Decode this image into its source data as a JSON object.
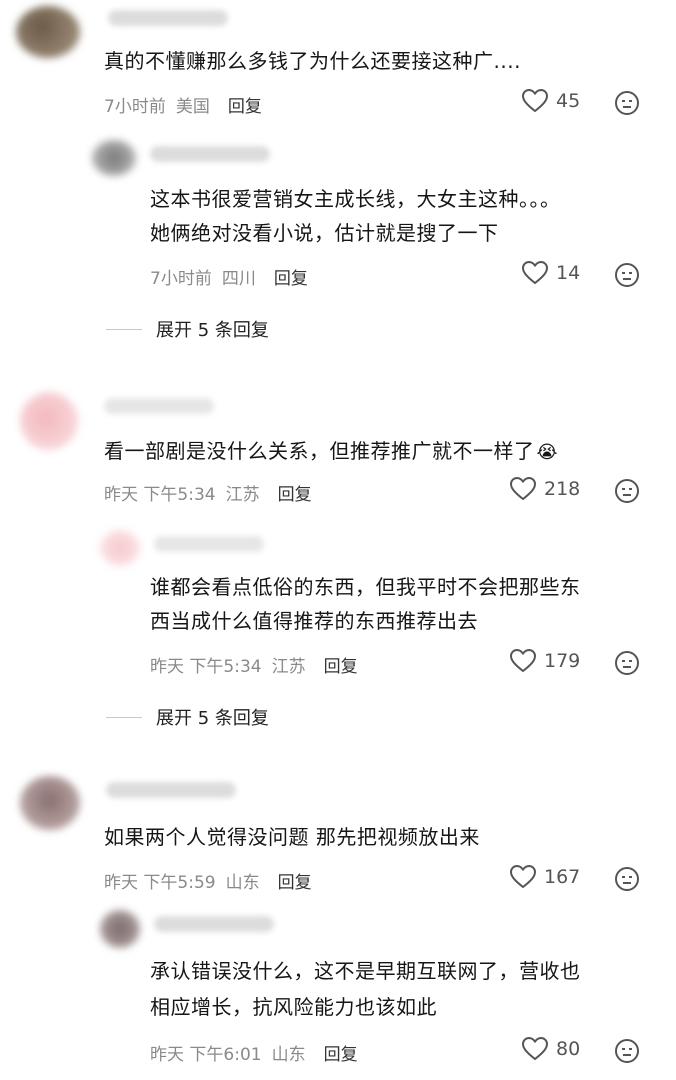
{
  "comments": [
    {
      "text_lines": [
        "真的不懂赚那么多钱了为什么还要接这种广...."
      ],
      "time": "7小时前",
      "location": "美国",
      "reply_label": "回复",
      "likes": "45"
    },
    {
      "text_lines": [
        "这本书很爱营销女主成长线，大女主这种。。。",
        "她俩绝对没看小说，估计就是搜了一下"
      ],
      "time": "7小时前",
      "location": "四川",
      "reply_label": "回复",
      "likes": "14"
    },
    {
      "text_lines": [
        "看一部剧是没什么关系，但推荐推广就不一样了"
      ],
      "time": "昨天 下午5:34",
      "location": "江苏",
      "reply_label": "回复",
      "likes": "218"
    },
    {
      "text_lines": [
        "谁都会看点低俗的东西，但我平时不会把那些东",
        "西当成什么值得推荐的东西推荐出去"
      ],
      "time": "昨天 下午5:34",
      "location": "江苏",
      "reply_label": "回复",
      "likes": "179"
    },
    {
      "text_lines": [
        "如果两个人觉得没问题 那先把视频放出来"
      ],
      "time": "昨天 下午5:59",
      "location": "山东",
      "reply_label": "回复",
      "likes": "167"
    },
    {
      "text_lines": [
        "承认错误没什么，这不是早期互联网了，营收也",
        "相应增长，抗风险能力也该如此"
      ],
      "time": "昨天 下午6:01",
      "location": "山东",
      "reply_label": "回复",
      "likes": "80"
    }
  ],
  "expand_1": "展开 5 条回复",
  "expand_2": "展开 5 条回复",
  "emoji": "😭"
}
